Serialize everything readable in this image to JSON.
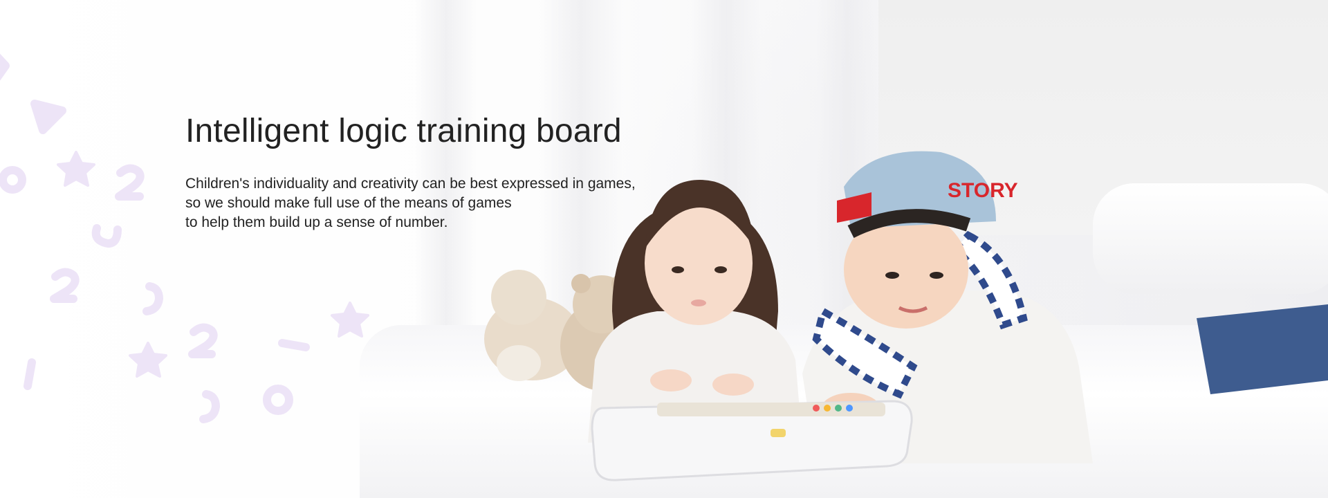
{
  "banner": {
    "title": "Intelligent logic training board",
    "description_lines": [
      "Children's individuality and creativity can be best expressed in games,",
      "so we should make full use of the means of games",
      "to help them build up a sense of number."
    ]
  },
  "decor": {
    "pattern_color": "#ede4f7",
    "pattern_glyphs": [
      "3",
      "2",
      "2",
      "1",
      "0"
    ],
    "cap_text": "STORY"
  },
  "colors": {
    "text": "#222222",
    "background": "#fbfbfb",
    "cap": "#a9c3d9",
    "cap_strap": "#d8262c",
    "stripe": "#2f4a8c"
  }
}
